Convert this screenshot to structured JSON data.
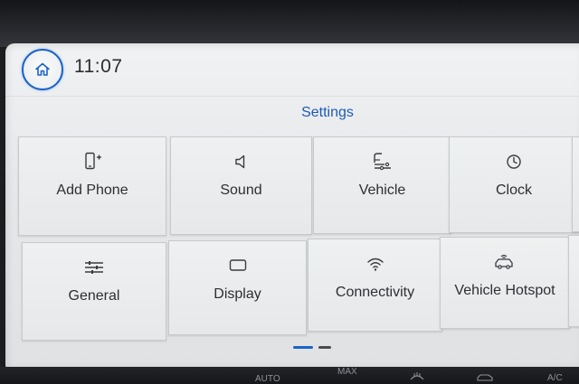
{
  "header": {
    "time": "11:07"
  },
  "page": {
    "title": "Settings"
  },
  "tiles": [
    {
      "label": "Add Phone",
      "icon": "add-phone-icon"
    },
    {
      "label": "Sound",
      "icon": "speaker-icon"
    },
    {
      "label": "Vehicle",
      "icon": "vehicle-settings-icon"
    },
    {
      "label": "Clock",
      "icon": "clock-icon"
    },
    {
      "label": "General",
      "icon": "sliders-icon"
    },
    {
      "label": "Display",
      "icon": "display-icon"
    },
    {
      "label": "Connectivity",
      "icon": "wifi-icon"
    },
    {
      "label": "Vehicle Hotspot",
      "icon": "car-hotspot-icon"
    }
  ],
  "pager": {
    "pages": 2,
    "current": 1
  },
  "climate_bar": {
    "auto_label": "AUTO",
    "max_label": "MAX",
    "ac_label": "A/C"
  },
  "colors": {
    "accent": "#1a64c9",
    "tile_bg": "#e9ebed",
    "text": "#2d2f33"
  }
}
